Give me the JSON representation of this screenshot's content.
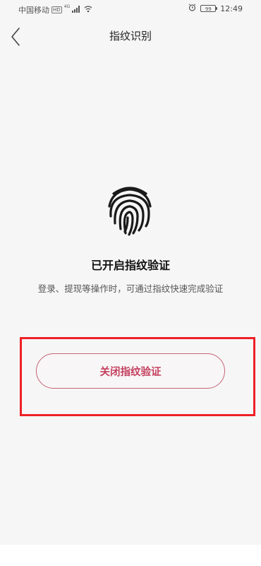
{
  "status_bar": {
    "carrier": "中国移动",
    "hd_badge": "HD",
    "network_tech": "4G",
    "battery": "99",
    "time": "12:49",
    "icons": [
      "signal-icon",
      "wifi-icon",
      "alarm-icon",
      "battery-icon"
    ]
  },
  "nav": {
    "back_icon": "back-chevron-icon",
    "title": "指纹识别"
  },
  "main": {
    "fingerprint_icon": "fingerprint-icon",
    "status_title": "已开启指纹验证",
    "description": "登录、提现等操作时，可通过指纹快速完成验证"
  },
  "action": {
    "disable_label": "关闭指纹验证"
  },
  "colors": {
    "accent": "#c4405f",
    "button_border": "#c56478",
    "highlight": "#ee2026",
    "background": "#f6f6f6"
  }
}
